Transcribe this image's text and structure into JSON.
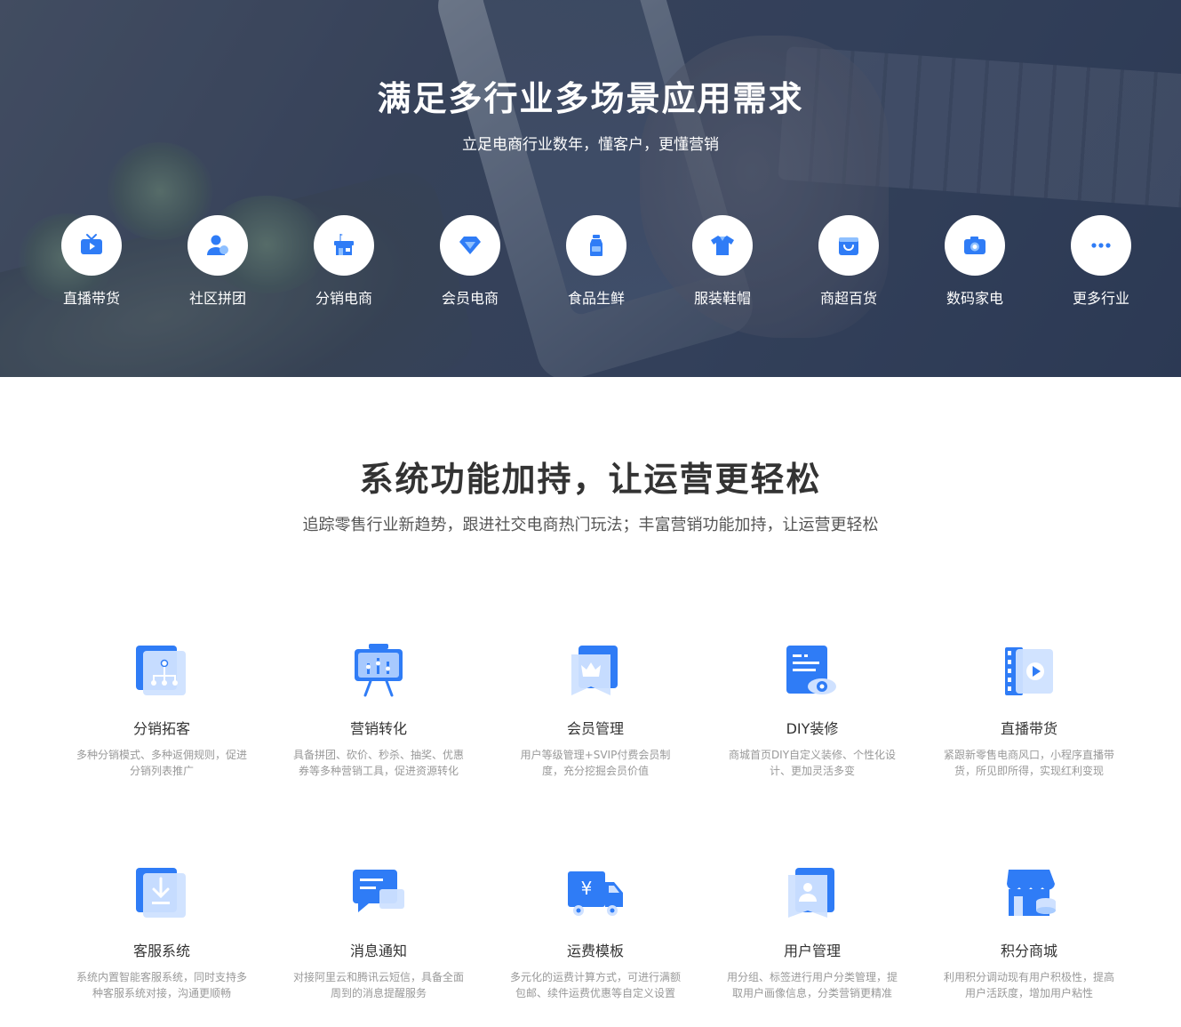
{
  "hero": {
    "title": "满足多行业多场景应用需求",
    "subtitle": "立足电商行业数年，懂客户，更懂营销",
    "industries": [
      {
        "label": "直播带货",
        "icon": "tv-icon"
      },
      {
        "label": "社区拼团",
        "icon": "users-icon"
      },
      {
        "label": "分销电商",
        "icon": "store-icon"
      },
      {
        "label": "会员电商",
        "icon": "diamond-icon"
      },
      {
        "label": "食品生鲜",
        "icon": "milk-bottle-icon"
      },
      {
        "label": "服装鞋帽",
        "icon": "shirt-icon"
      },
      {
        "label": "商超百货",
        "icon": "shopping-bag-icon"
      },
      {
        "label": "数码家电",
        "icon": "camera-icon"
      },
      {
        "label": "更多行业",
        "icon": "more-dots-icon"
      }
    ]
  },
  "features": {
    "title": "系统功能加持，让运营更轻松",
    "subtitle": "追踪零售行业新趋势，跟进社交电商热门玩法；丰富营销功能加持，让运营更轻松",
    "items": [
      {
        "title": "分销拓客",
        "desc": "多种分销模式、多种返佣规则，促进分销列表推广",
        "icon": "distribution-network-icon"
      },
      {
        "title": "营销转化",
        "desc": "具备拼团、砍价、秒杀、抽奖、优惠券等多种营销工具，促进资源转化",
        "icon": "presentation-board-icon"
      },
      {
        "title": "会员管理",
        "desc": "用户等级管理+SVIP付费会员制度，充分挖掘会员价值",
        "icon": "crown-badge-icon"
      },
      {
        "title": "DIY装修",
        "desc": "商城首页DIY自定义装修、个性化设计、更加灵活多变",
        "icon": "document-eye-icon"
      },
      {
        "title": "直播带货",
        "desc": "紧跟新零售电商风口，小程序直播带货，所见即所得，实现红利变现",
        "icon": "video-film-icon"
      },
      {
        "title": "客服系统",
        "desc": "系统内置智能客服系统，同时支持多种客服系统对接，沟通更顺畅",
        "icon": "download-box-icon"
      },
      {
        "title": "消息通知",
        "desc": "对接阿里云和腾讯云短信，具备全面周到的消息提醒服务",
        "icon": "message-bubble-icon"
      },
      {
        "title": "运费模板",
        "desc": "多元化的运费计算方式，可进行满额包邮、续件运费优惠等自定义设置",
        "icon": "delivery-truck-icon"
      },
      {
        "title": "用户管理",
        "desc": "用分组、标签进行用户分类管理，提取用户画像信息，分类营销更精准",
        "icon": "user-card-icon"
      },
      {
        "title": "积分商城",
        "desc": "利用积分调动现有用户积极性，提高用户活跃度，增加用户粘性",
        "icon": "shop-coins-icon"
      }
    ]
  },
  "colors": {
    "accent": "#2f7cf6",
    "accent_light": "#8fc0ff"
  }
}
